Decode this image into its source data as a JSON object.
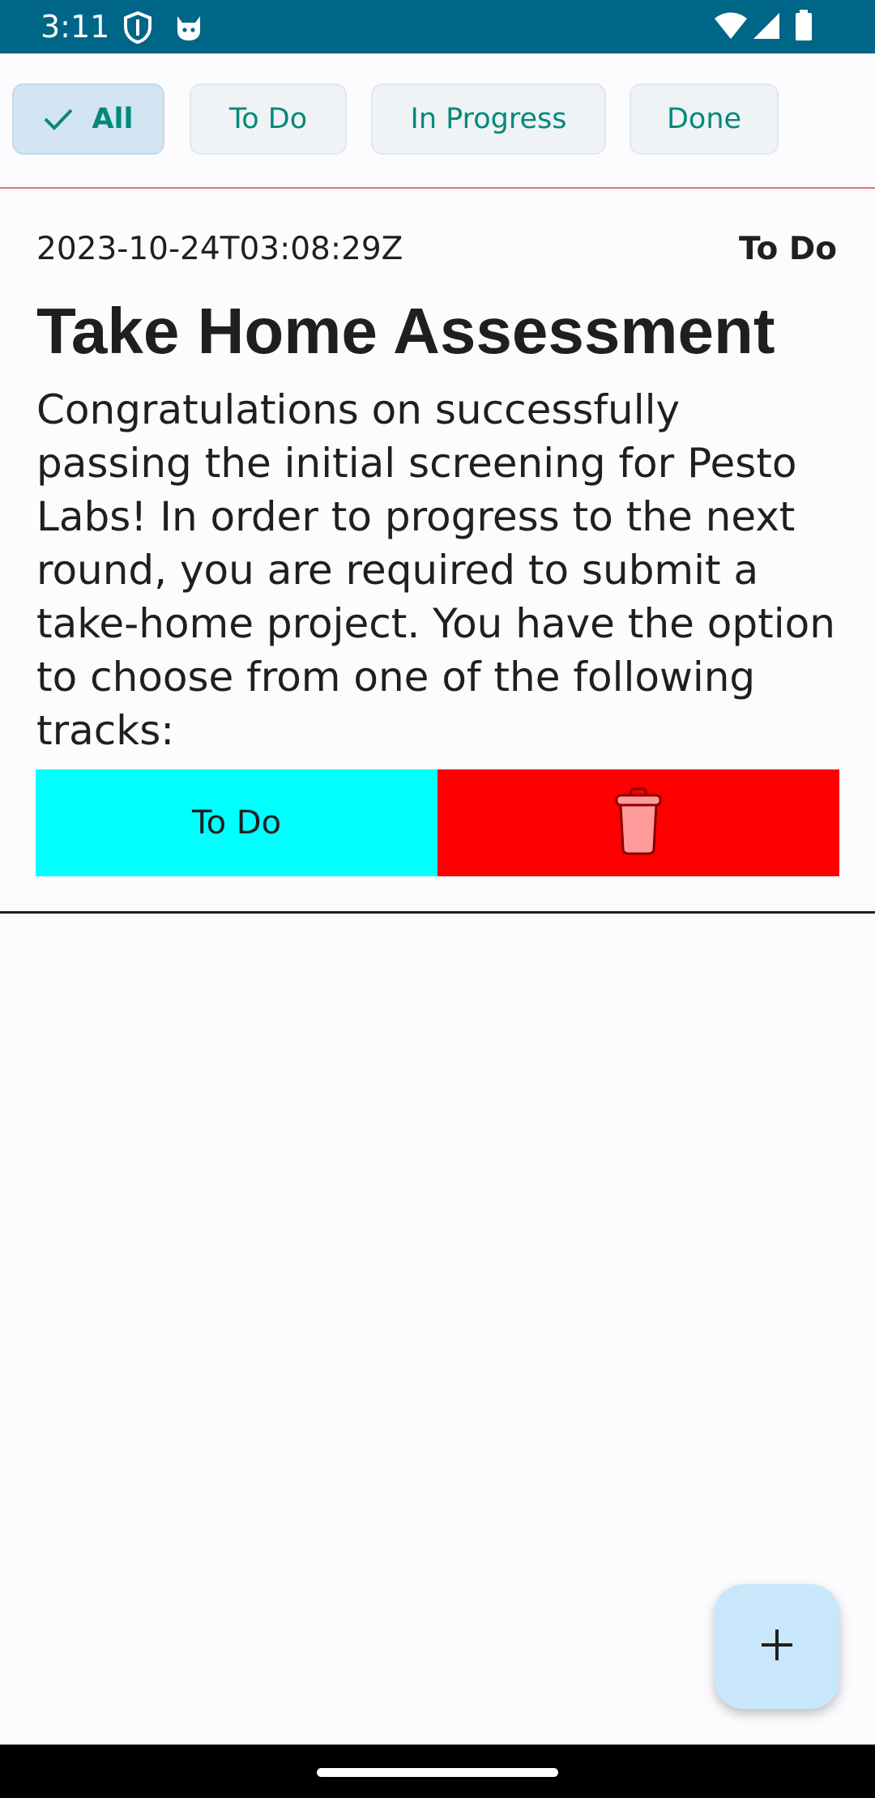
{
  "status_bar": {
    "time": "3:11",
    "icons": [
      "shield-icon",
      "cat-icon",
      "wifi-icon",
      "signal-icon",
      "battery-icon"
    ]
  },
  "filters": {
    "chips": [
      {
        "label": "All",
        "selected": true
      },
      {
        "label": "To Do",
        "selected": false
      },
      {
        "label": "In Progress",
        "selected": false
      },
      {
        "label": "Done",
        "selected": false
      }
    ]
  },
  "task": {
    "date": "2023-10-24T03:08:29Z",
    "status": "To Do",
    "title": "Take Home Assessment",
    "description": "Congratulations on successfully passing the initial screening for Pesto Labs! In order to progress to the next round, you are required to submit a take-home project. You have the option to choose from one of the following tracks:",
    "status_button_label": "To Do",
    "delete_icon": "trash-icon"
  },
  "fab": {
    "icon": "plus-icon"
  },
  "colors": {
    "status_bar": "#006688",
    "chip_text": "#00897b",
    "status_button": "#00ffff",
    "delete_button": "#ff0000",
    "fab": "#c9e7fb"
  }
}
